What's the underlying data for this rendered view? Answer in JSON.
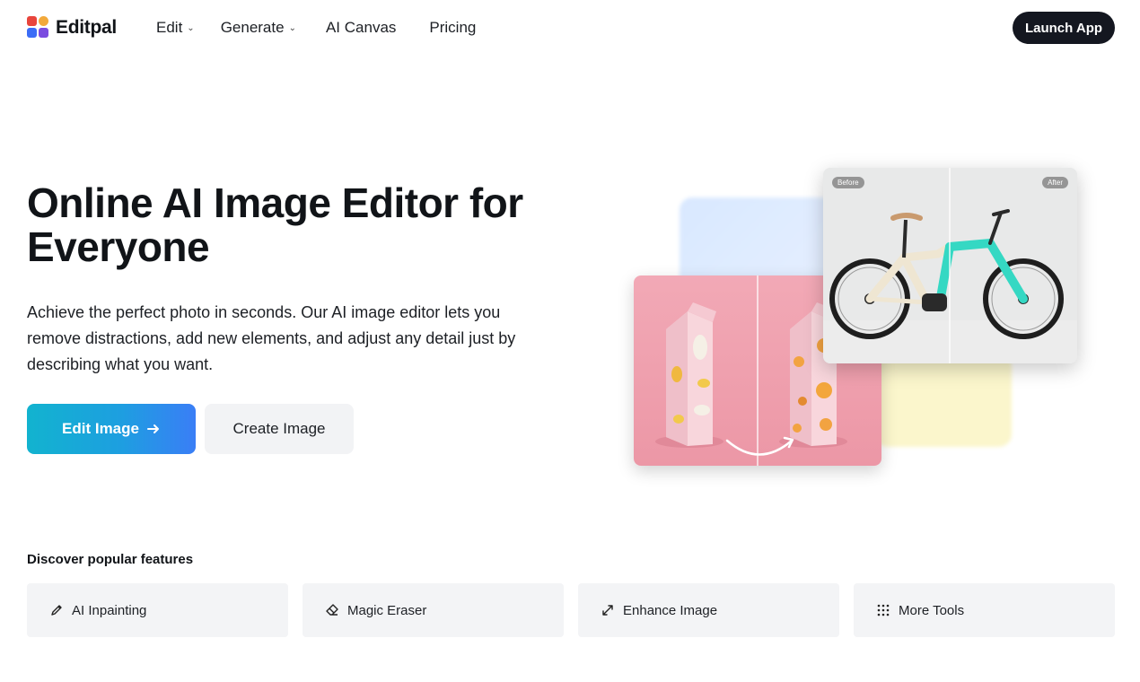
{
  "brand": {
    "name": "Editpal",
    "colors": [
      "#e8453c",
      "#3b6cf6",
      "#f2a93b",
      "#7b4ce0"
    ]
  },
  "nav": {
    "items": [
      {
        "label": "Edit",
        "has_dropdown": true
      },
      {
        "label": "Generate",
        "has_dropdown": true
      },
      {
        "label": "AI Canvas",
        "has_dropdown": false
      },
      {
        "label": "Pricing",
        "has_dropdown": false
      }
    ],
    "cta_label": "Launch App"
  },
  "hero": {
    "title": "Online AI Image Editor for Everyone",
    "description": "Achieve the perfect photo in seconds. Our AI image editor lets you remove distractions, add new elements, and adjust any detail just by describing what you want.",
    "primary_button": "Edit Image",
    "secondary_button": "Create Image",
    "before_tag": "Before",
    "after_tag": "After",
    "accent_gradient": [
      "#12b3cf",
      "#3a7ef6"
    ]
  },
  "features": {
    "title": "Discover popular features",
    "items": [
      {
        "label": "AI Inpainting",
        "icon": "pencil-icon"
      },
      {
        "label": "Magic Eraser",
        "icon": "eraser-icon"
      },
      {
        "label": "Enhance Image",
        "icon": "expand-arrows-icon"
      },
      {
        "label": "More Tools",
        "icon": "grid-dots-icon"
      }
    ]
  }
}
